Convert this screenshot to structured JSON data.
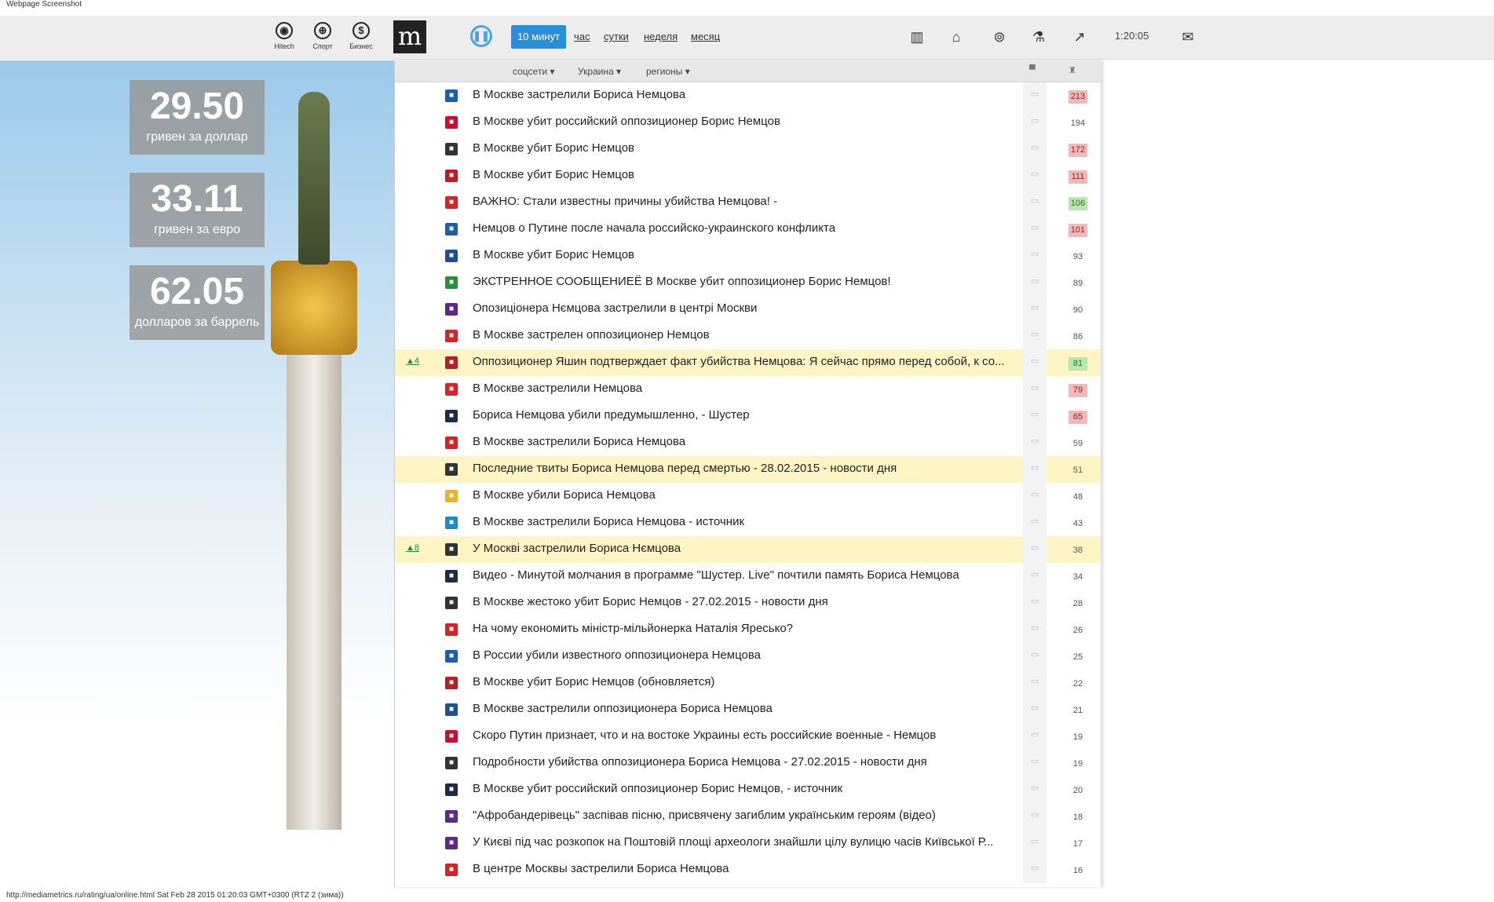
{
  "caption": "Webpage Screenshot",
  "header": {
    "categories": [
      {
        "label": "Hitech",
        "icon": "chrome-icon"
      },
      {
        "label": "Спорт",
        "icon": "ball-icon"
      },
      {
        "label": "Бизнес",
        "icon": "dollar-icon"
      }
    ],
    "logo": "m",
    "periods": [
      "10 минут",
      "час",
      "сутки",
      "неделя",
      "месяц"
    ],
    "active_period": "10 минут",
    "clock": "1:20:05"
  },
  "rates": [
    {
      "value": "29.50",
      "label": "гривен за доллар"
    },
    {
      "value": "33.11",
      "label": "гривен за евро"
    },
    {
      "value": "62.05",
      "label": "долларов за баррель"
    }
  ],
  "filters": [
    "соцсети",
    "Украина",
    "регионы"
  ],
  "news": [
    {
      "title": "В Москве застрелили Бориса Немцова",
      "count": "213",
      "badge": "red",
      "src_color": "#1d5ea8",
      "trend": "",
      "hl": false
    },
    {
      "title": "В Москве убит российский оппозиционер Борис Немцов",
      "count": "194",
      "badge": "",
      "src_color": "#c8102e",
      "trend": "",
      "hl": false
    },
    {
      "title": "В Москве убит Борис Немцов",
      "count": "172",
      "badge": "red",
      "src_color": "#333333",
      "trend": "",
      "hl": false
    },
    {
      "title": "В Москве убит Борис Немцов",
      "count": "111",
      "badge": "red",
      "src_color": "#b51f24",
      "trend": "",
      "hl": false
    },
    {
      "title": "ВАЖНО: Стали известны причины убийства Немцова! -",
      "count": "106",
      "badge": "green",
      "src_color": "#d0262a",
      "trend": "",
      "hl": false
    },
    {
      "title": "Немцов о Путине после начала российско-украинского конфликта",
      "count": "101",
      "badge": "red",
      "src_color": "#1d5ea8",
      "trend": "",
      "hl": false
    },
    {
      "title": "В Москве убит Борис Немцов",
      "count": "93",
      "badge": "",
      "src_color": "#1d4f91",
      "trend": "",
      "hl": false
    },
    {
      "title": "ЭКСТРЕННОЕ СООБЩЕНИЕЁ В Москве убит оппозиционер Борис Немцов!",
      "count": "89",
      "badge": "",
      "src_color": "#2a8f3a",
      "trend": "",
      "hl": false
    },
    {
      "title": "Опозиціонера Нємцова застрелили в центрі Москви",
      "count": "90",
      "badge": "",
      "src_color": "#5b2a86",
      "trend": "",
      "hl": false
    },
    {
      "title": "В Москве застрелен оппозиционер Немцов",
      "count": "86",
      "badge": "",
      "src_color": "#d0262a",
      "trend": "",
      "hl": false
    },
    {
      "title": "Оппозиционер Яшин подтверждает факт убийства Немцова: Я сейчас прямо перед собой, к со...",
      "count": "81",
      "badge": "green",
      "src_color": "#b51f24",
      "trend": "▲4",
      "hl": true
    },
    {
      "title": "В Москве застрелили Немцова",
      "count": "79",
      "badge": "red",
      "src_color": "#d0262a",
      "trend": "",
      "hl": false
    },
    {
      "title": "Бориса Немцова убили предумышленно, - Шустер",
      "count": "65",
      "badge": "red",
      "src_color": "#1f2a44",
      "trend": "",
      "hl": false
    },
    {
      "title": "В Москве застрелили Бориса Немцова",
      "count": "59",
      "badge": "",
      "src_color": "#d0262a",
      "trend": "",
      "hl": false
    },
    {
      "title": "Последние твиты Бориса Немцова перед смертью - 28.02.2015 - новости дня",
      "count": "51",
      "badge": "",
      "src_color": "#333333",
      "trend": "",
      "hl": true
    },
    {
      "title": "В Москве убили Бориса Немцова",
      "count": "48",
      "badge": "",
      "src_color": "#e8b32a",
      "trend": "",
      "hl": false
    },
    {
      "title": "В Москве застрелили Бориса Немцова - источник",
      "count": "43",
      "badge": "",
      "src_color": "#1e88c8",
      "trend": "",
      "hl": false
    },
    {
      "title": "У Москві застрелили Бориса Нємцова",
      "count": "38",
      "badge": "",
      "src_color": "#333333",
      "trend": "▲8",
      "hl": true
    },
    {
      "title": "Видео - Минутой молчания в программе \"Шустер. Live\" почтили память Бориса Немцова",
      "count": "34",
      "badge": "",
      "src_color": "#1f2a44",
      "trend": "",
      "hl": false
    },
    {
      "title": "В Москве жестоко убит Борис Немцов - 27.02.2015 - новости дня",
      "count": "28",
      "badge": "",
      "src_color": "#333333",
      "trend": "",
      "hl": false
    },
    {
      "title": "На чому економить міністр-мільйонерка Наталія Яресько?",
      "count": "26",
      "badge": "",
      "src_color": "#d0262a",
      "trend": "",
      "hl": false
    },
    {
      "title": "В России убили известного оппозиционера Немцова",
      "count": "25",
      "badge": "",
      "src_color": "#1d5ea8",
      "trend": "",
      "hl": false
    },
    {
      "title": "В Москве убит Борис Немцов (обновляется)",
      "count": "22",
      "badge": "",
      "src_color": "#b51f24",
      "trend": "",
      "hl": false
    },
    {
      "title": "В Москве застрелили оппозиционера Бориса Немцова",
      "count": "21",
      "badge": "",
      "src_color": "#1d4f91",
      "trend": "",
      "hl": false
    },
    {
      "title": "Скоро Путин признает, что и на востоке Украины есть российские военные - Немцов",
      "count": "19",
      "badge": "",
      "src_color": "#c8102e",
      "trend": "",
      "hl": false
    },
    {
      "title": "Подробности убийства оппозиционера Бориса Немцова - 27.02.2015 - новости дня",
      "count": "19",
      "badge": "",
      "src_color": "#333333",
      "trend": "",
      "hl": false
    },
    {
      "title": "В Москве убит российский оппозиционер Борис Немцов, - источник",
      "count": "20",
      "badge": "",
      "src_color": "#1f2a44",
      "trend": "",
      "hl": false
    },
    {
      "title": "\"Афробандерівець\" заспівав пісню, присвячену загиблим українським героям (відео)",
      "count": "18",
      "badge": "",
      "src_color": "#5b2a86",
      "trend": "",
      "hl": false
    },
    {
      "title": "У Києві під час розкопок на Поштовій площі археологи знайшли цілу вулицю часів Київської Р...",
      "count": "17",
      "badge": "",
      "src_color": "#5b2a86",
      "trend": "",
      "hl": false
    },
    {
      "title": "В центре Москвы застрелили Бориса Немцова",
      "count": "16",
      "badge": "",
      "src_color": "#d0262a",
      "trend": "",
      "hl": false
    }
  ],
  "footer": "http://mediametrics.ru/rating/ua/online.html Sat Feb 28 2015 01:20:03 GMT+0300 (RTZ 2 (зима))"
}
